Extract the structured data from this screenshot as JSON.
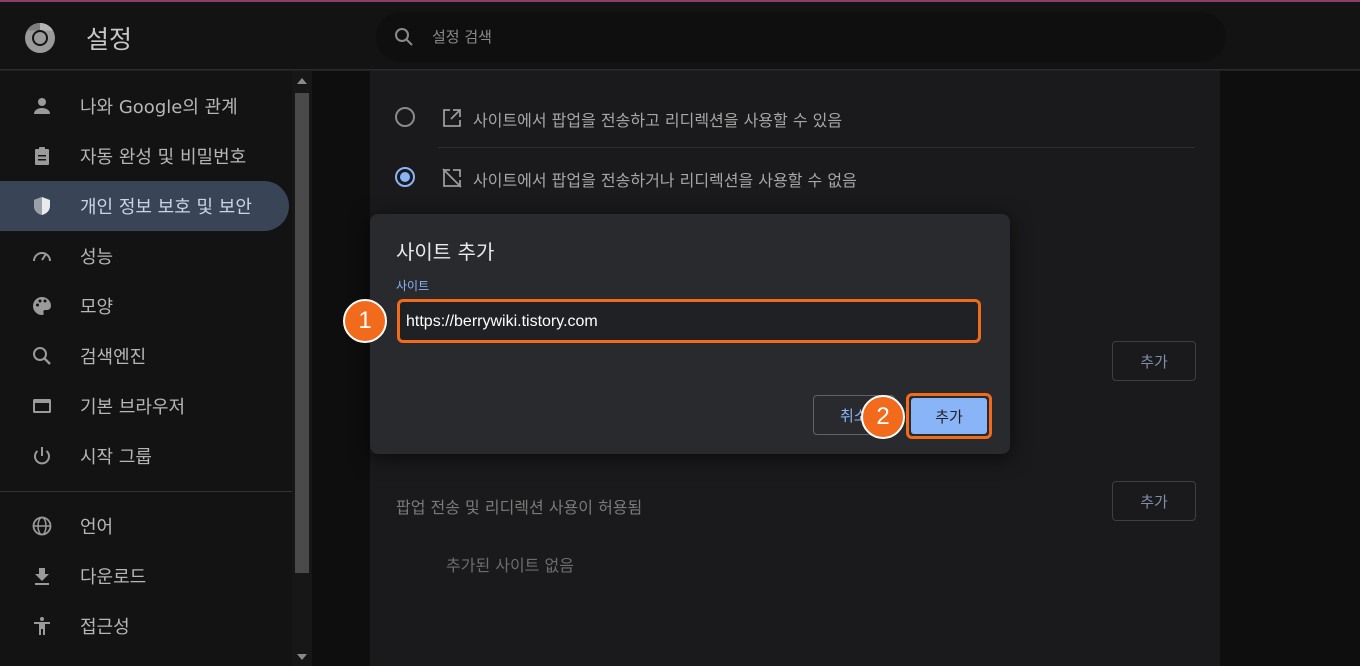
{
  "header": {
    "app_title": "설정",
    "search_placeholder": "설정 검색"
  },
  "sidebar": {
    "items": [
      {
        "label": "나와 Google의 관계",
        "icon": "person-icon"
      },
      {
        "label": "자동 완성 및 비밀번호",
        "icon": "clipboard-icon"
      },
      {
        "label": "개인 정보 보호 및 보안",
        "icon": "shield-icon",
        "active": true
      },
      {
        "label": "성능",
        "icon": "speedometer-icon"
      },
      {
        "label": "모양",
        "icon": "palette-icon"
      },
      {
        "label": "검색엔진",
        "icon": "search-icon"
      },
      {
        "label": "기본 브라우저",
        "icon": "browser-icon"
      },
      {
        "label": "시작 그룹",
        "icon": "power-icon"
      },
      {
        "label": "언어",
        "icon": "globe-icon"
      },
      {
        "label": "다운로드",
        "icon": "download-icon"
      },
      {
        "label": "접근성",
        "icon": "accessibility-icon"
      }
    ]
  },
  "content": {
    "option_allow": "사이트에서 팝업을 전송하고 리디렉션을 사용할 수 있음",
    "option_block": "사이트에서 팝업을 전송하거나 리디렉션을 사용할 수 없음",
    "add_label": "추가",
    "allowed_section_label": "팝업 전송 및 리디렉션 사용이 허용됨",
    "no_sites_label": "추가된 사이트 없음"
  },
  "dialog": {
    "title": "사이트 추가",
    "field_label": "사이트",
    "field_value": "https://berrywiki.tistory.com",
    "cancel_label": "취소",
    "add_label": "추가"
  },
  "annotations": {
    "marker_1": "1",
    "marker_2": "2"
  },
  "colors": {
    "accent": "#8ab4f8",
    "highlight": "#f26a1b",
    "active_nav": "#394457"
  }
}
